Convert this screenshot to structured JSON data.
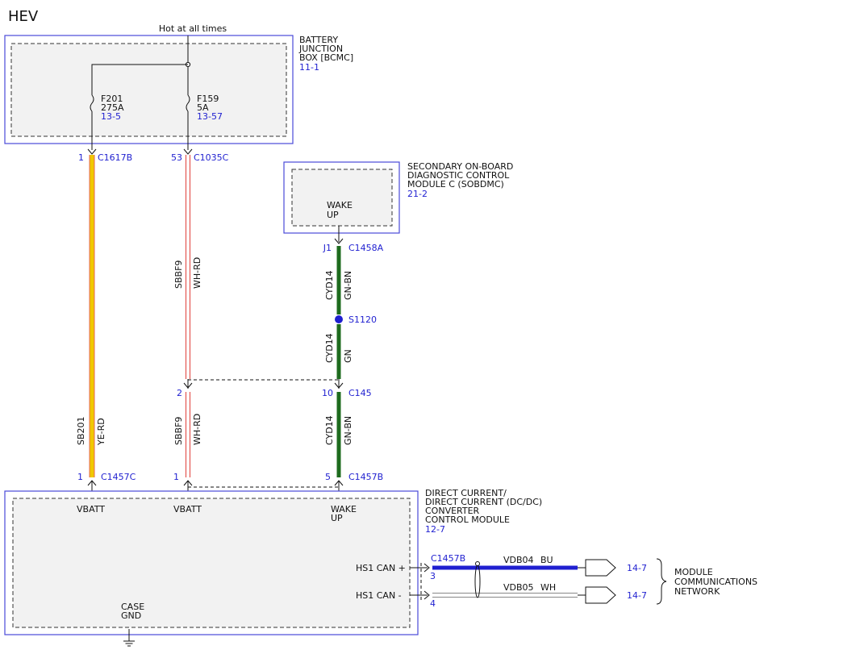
{
  "diagram": {
    "title": "HEV",
    "hot_label": "Hot at all times",
    "colors": {
      "yellow": "#f0c800",
      "red": "#e0403a",
      "green": "#1e6b1e",
      "blue": "#1f1fd0",
      "module_border": "#4a4ad8"
    },
    "bjb": {
      "name_lines": [
        "BATTERY",
        "JUNCTION",
        "BOX [BCMC]"
      ],
      "ref": "11-1",
      "fuses": [
        {
          "name": "F201",
          "rating": "275A",
          "ref": "13-5"
        },
        {
          "name": "F159",
          "rating": "5A",
          "ref": "13-57"
        }
      ]
    },
    "sobdmc": {
      "name_lines": [
        "SECONDARY ON-BOARD",
        "DIAGNOSTIC CONTROL",
        "MODULE C (SOBDMC)"
      ],
      "ref": "21-2",
      "pin_label_lines": [
        "WAKE",
        "UP"
      ]
    },
    "dcdc": {
      "name_lines": [
        "DIRECT CURRENT/",
        "DIRECT CURRENT (DC/DC)",
        "CONVERTER",
        "CONTROL MODULE"
      ],
      "ref": "12-7",
      "vbatt1": "VBATT",
      "vbatt2": "VBATT",
      "wake_lines": [
        "WAKE",
        "UP"
      ],
      "can_high": "HS1 CAN +",
      "can_low": "HS1 CAN -",
      "case_gnd_lines": [
        "CASE",
        "GND"
      ]
    },
    "connectors": {
      "c1617b": {
        "pin": "1",
        "name": "C1617B"
      },
      "c1035c": {
        "pin": "53",
        "name": "C1035C"
      },
      "c1458a": {
        "pin": "J1",
        "name": "C1458A"
      },
      "c145_left": {
        "pin": "2"
      },
      "c145_right": {
        "pin": "10",
        "name": "C145"
      },
      "c1457c": {
        "pin": "1",
        "name": "C1457C"
      },
      "c1457b_left": {
        "pin": "1"
      },
      "c1457b_right": {
        "pin": "5",
        "name": "C1457B"
      },
      "c1457b_can": {
        "name": "C1457B",
        "pin_high": "3",
        "pin_low": "4"
      }
    },
    "splice": {
      "name": "S1120"
    },
    "wires": {
      "sb201": {
        "circuit": "SB201",
        "color": "YE-RD"
      },
      "sbbf9_upper": {
        "circuit": "SBBF9",
        "color": "WH-RD"
      },
      "sbbf9_lower": {
        "circuit": "SBBF9",
        "color": "WH-RD"
      },
      "cyd14_a": {
        "circuit": "CYD14",
        "color": "GN-BN"
      },
      "cyd14_b": {
        "circuit": "CYD14",
        "color": "GN"
      },
      "cyd14_c": {
        "circuit": "CYD14",
        "color": "GN-BN"
      },
      "vdb04": {
        "circuit": "VDB04",
        "color": "BU"
      },
      "vdb05": {
        "circuit": "VDB05",
        "color": "WH"
      }
    },
    "network": {
      "ref_high": "14-7",
      "ref_low": "14-7",
      "name_lines": [
        "MODULE",
        "COMMUNICATIONS",
        "NETWORK"
      ]
    }
  }
}
